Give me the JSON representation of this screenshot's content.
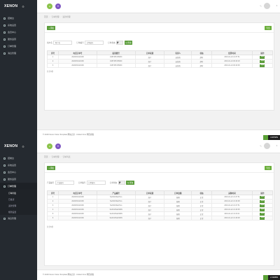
{
  "brand": "XENON",
  "colors": {
    "sidebar": "#252a30",
    "accent": "#5c9d3c",
    "purple": "#7e57c2"
  },
  "icons": {
    "gear": "gear-icon",
    "pencil": "pencil-icon",
    "avatar": "avatar-icon"
  },
  "panel1": {
    "sidebar": [
      "控制台",
      "系统设置",
      "会员中心",
      "服务运营",
      "订单管理",
      "消息管理"
    ],
    "breadcrumb": [
      "首页",
      "订单管理",
      "退款管理"
    ],
    "add_label": "+ 添加",
    "export_label": "导出",
    "search": {
      "label1": "用户名",
      "placeholder1": "用户名",
      "label2": "订单编号",
      "placeholder2": "订单编号",
      "label3": "订单状态",
      "select": "全部",
      "button": "Q 查询"
    },
    "table": {
      "headers": [
        "序号",
        "电话订单号",
        "投资账号",
        "订单来源",
        "有序人",
        "状态",
        "结算时间",
        "操作"
      ],
      "rows": [
        [
          "1",
          "2020030121099",
          "1987387236660",
          "商户",
          "运营商",
          "超时",
          "2019-01-24 13:37:51",
          "编辑"
        ],
        [
          "2",
          "2020030121099",
          "1987387236660",
          "商户",
          "运营商",
          "超时",
          "2019-01-24 06:40:18",
          "编辑"
        ],
        [
          "3",
          "2020030121099",
          "1987387236660",
          "商户",
          "运营商",
          "超时",
          "2019-01-24 06:40:38",
          "编辑"
        ]
      ]
    },
    "total": "共计3条",
    "footer": "© 2018 Xenon Voice Template 网站之家 - Collect from 网页模板",
    "badge": "3.005959"
  },
  "panel2": {
    "sidebar": [
      "控制台",
      "系统设置",
      "会员中心",
      "服务运营",
      "订单管理",
      "订单列表",
      "已发货",
      "退款管理",
      "规则设置",
      "消息管理"
    ],
    "breadcrumb": [
      "首页",
      "订单管理",
      "订单列表"
    ],
    "add_label": "+ 添加",
    "export_label": "导出",
    "search": {
      "label1": "产品编号",
      "placeholder1": "产品编号",
      "label2": "订单编号",
      "placeholder2": "订单编号",
      "label3": "订单状态",
      "select": "全部",
      "button": "Q 查询"
    },
    "table": {
      "headers": [
        "序号",
        "电话订单号",
        "产品编号",
        "订单来源",
        "订单金额",
        "状态",
        "采购时间",
        "操作"
      ],
      "rows": [
        [
          "1",
          "2020030121099",
          "Swh010SabTwo",
          "商户",
          "按期",
          "正常",
          "2019-01-22 21:27:51",
          "编辑"
        ],
        [
          "2",
          "2020030121099",
          "Swh010SabTwo",
          "商户",
          "按期",
          "正常",
          "2019-01-22 21:32:08",
          "编辑"
        ],
        [
          "3",
          "2020030121099",
          "Swh010SabTwo",
          "商户",
          "按期",
          "正常",
          "2019-01-22 21:27:51",
          "编辑"
        ],
        [
          "4",
          "2020030121099",
          "Swh010SabSMN",
          "商户",
          "按期",
          "正常",
          "2019-01-22 21:43:05",
          "编辑"
        ],
        [
          "5",
          "2020030121099",
          "Swh010SabSMN",
          "商户",
          "按期",
          "正常",
          "2019-01-22 21:43:11",
          "编辑"
        ],
        [
          "6",
          "2020030121099",
          "Swh010SabSMN",
          "商户",
          "按期",
          "正常",
          "2019-01-22 21:46:08",
          "编辑"
        ]
      ]
    },
    "total": "共计6条",
    "footer": "© 2018 Xenon Voice Template 网站之家 - Collect from 网页模板",
    "badge": "2.199899"
  }
}
